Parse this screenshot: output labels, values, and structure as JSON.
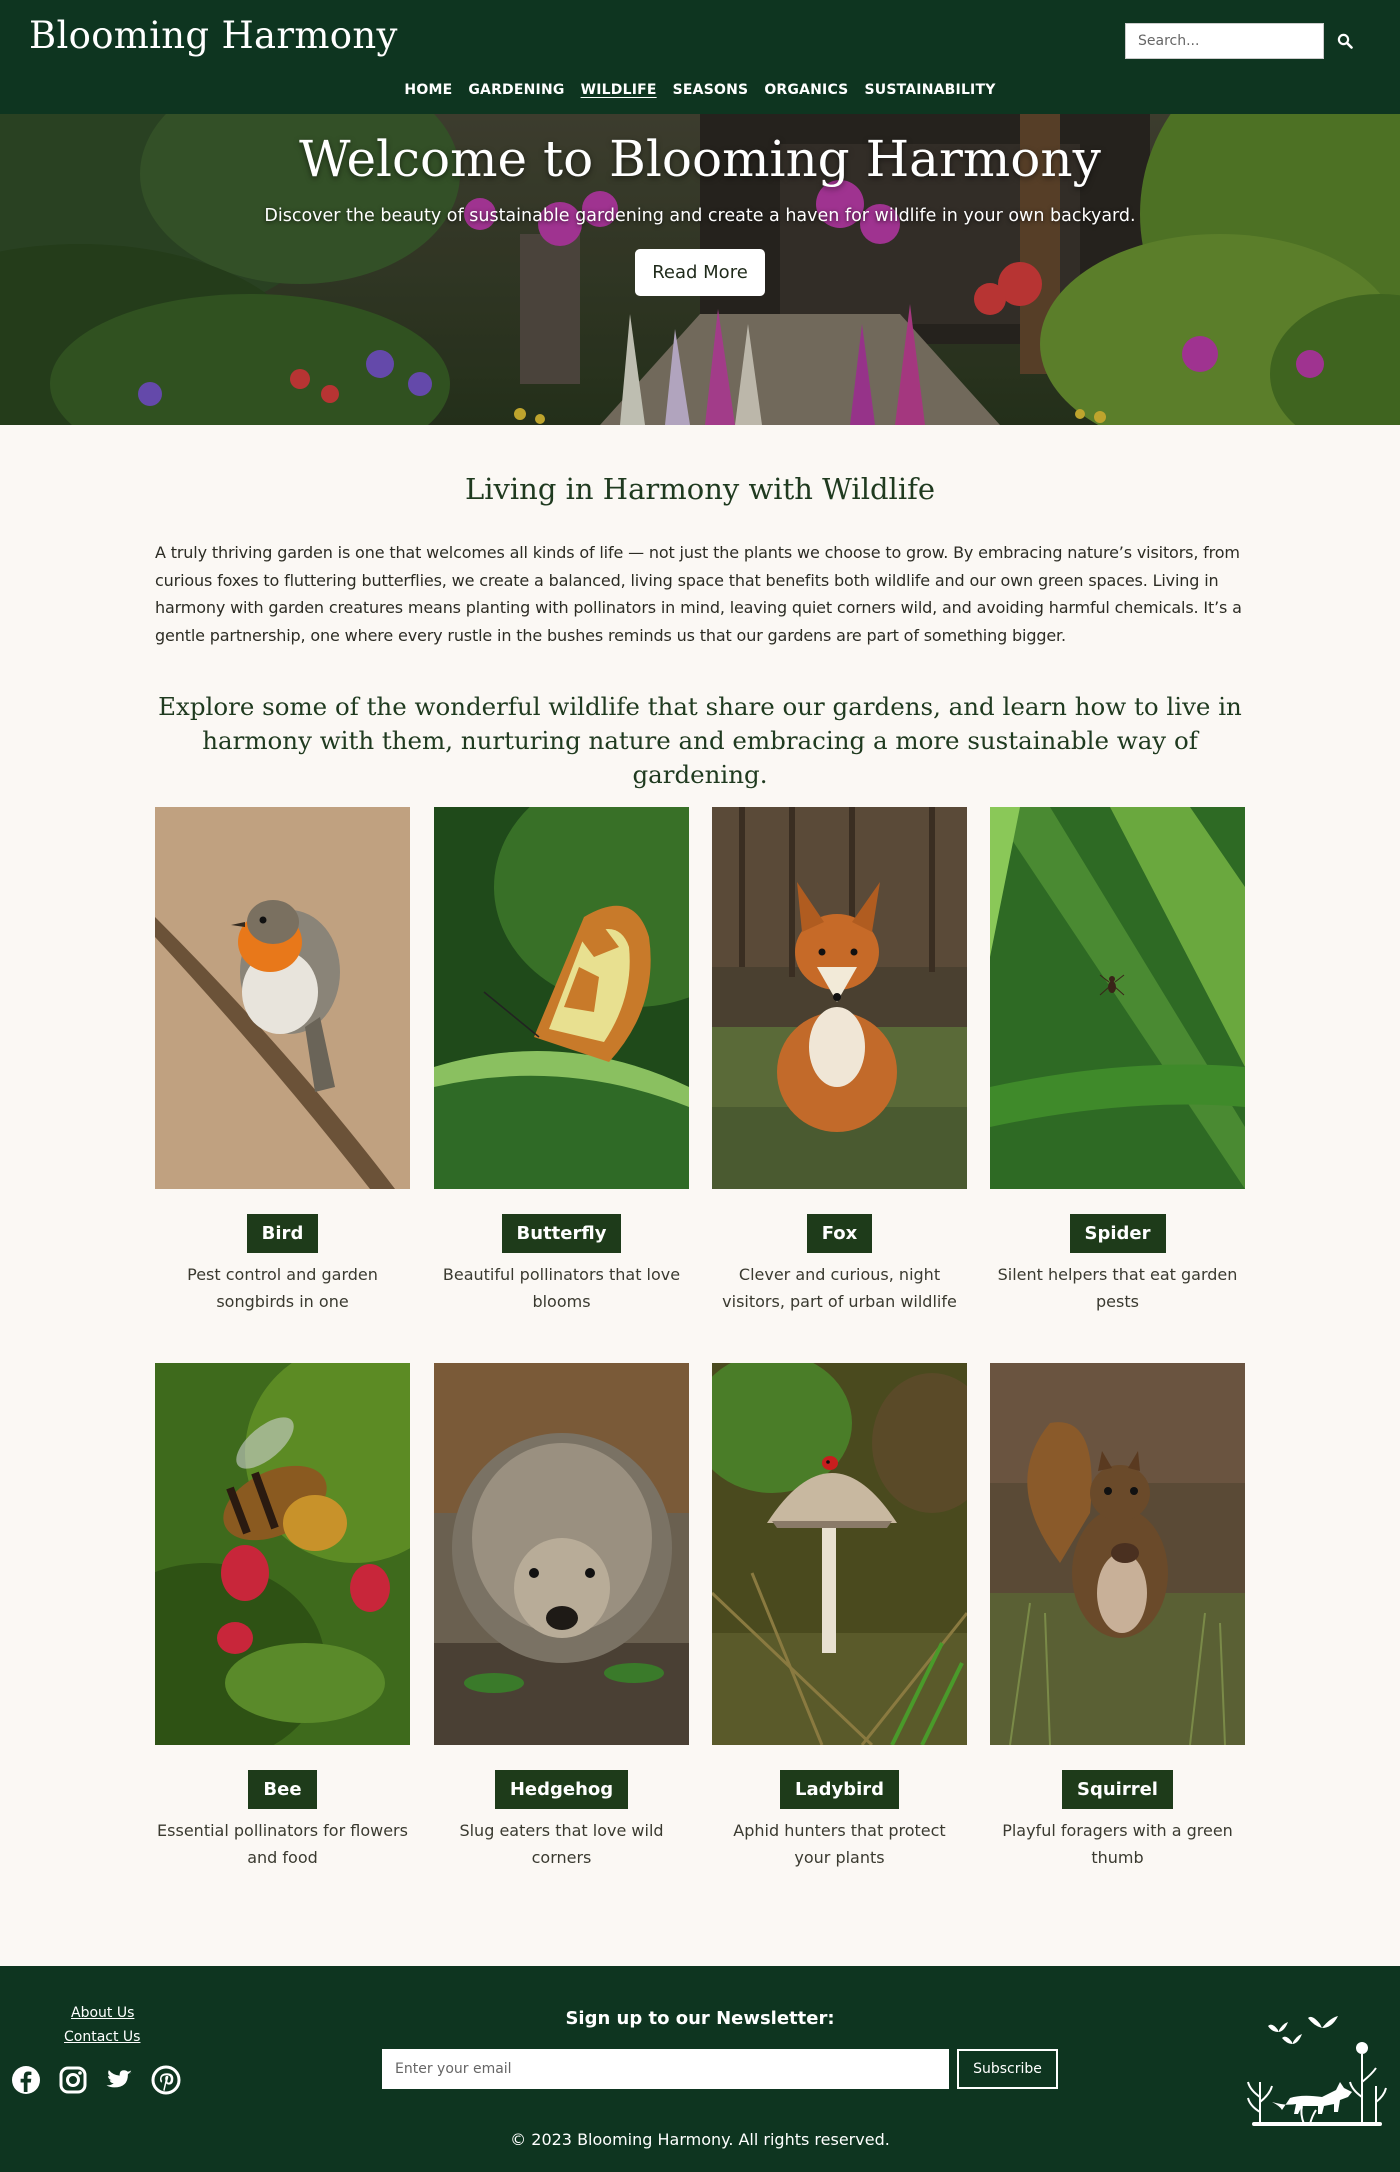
{
  "header": {
    "site_title": "Blooming Harmony",
    "search_placeholder": "Search..."
  },
  "nav": {
    "items": [
      {
        "label": "HOME"
      },
      {
        "label": "GARDENING"
      },
      {
        "label": "WILDLIFE",
        "active": true
      },
      {
        "label": "SEASONS"
      },
      {
        "label": "ORGANICS"
      },
      {
        "label": "SUSTAINABILITY"
      }
    ]
  },
  "hero": {
    "title": "Welcome to Blooming Harmony",
    "subtitle": "Discover the beauty of sustainable gardening and create a haven for wildlife in your own backyard.",
    "button_label": "Read More"
  },
  "main": {
    "section_title": "Living in Harmony with Wildlife",
    "intro": "A truly thriving garden is one that welcomes all kinds of life — not just the plants we choose to grow. By embracing nature’s visitors, from curious foxes to fluttering butterflies, we create a balanced, living space that benefits both wildlife and our own green spaces. Living in harmony with garden creatures means planting with pollinators in mind, leaving quiet corners wild, and avoiding harmful chemicals. It’s a gentle partnership, one where every rustle in the bushes reminds us that our gardens are part of something bigger.",
    "explore": "Explore some of the wonderful wildlife that share our gardens, and learn how to live in harmony with them, nurturing nature and embracing a more sustainable way of gardening.",
    "cards": [
      {
        "name": "Bird",
        "desc": "Pest control and garden songbirds in one"
      },
      {
        "name": "Butterfly",
        "desc": "Beautiful pollinators that love blooms"
      },
      {
        "name": "Fox",
        "desc": "Clever and curious, night visitors, part of urban wildlife"
      },
      {
        "name": "Spider",
        "desc": "Silent helpers that eat garden pests"
      },
      {
        "name": "Bee",
        "desc": "Essential pollinators for flowers and food"
      },
      {
        "name": "Hedgehog",
        "desc": "Slug eaters that love wild corners"
      },
      {
        "name": "Ladybird",
        "desc": "Aphid hunters that protect your plants"
      },
      {
        "name": "Squirrel",
        "desc": "Playful foragers with a green thumb"
      }
    ]
  },
  "footer": {
    "about_label": "About Us",
    "contact_label": "Contact Us",
    "social": [
      {
        "icon": "facebook-icon"
      },
      {
        "icon": "instagram-icon"
      },
      {
        "icon": "twitter-icon"
      },
      {
        "icon": "pinterest-icon"
      }
    ],
    "newsletter_title": "Sign up to our Newsletter:",
    "email_placeholder": "Enter your email",
    "subscribe_label": "Subscribe",
    "copyright": "© 2023 Blooming Harmony. All rights reserved."
  },
  "colors": {
    "brand_green": "#0e3520",
    "tag_green": "#1e3b1a",
    "page_bg": "#fbf8f4"
  }
}
